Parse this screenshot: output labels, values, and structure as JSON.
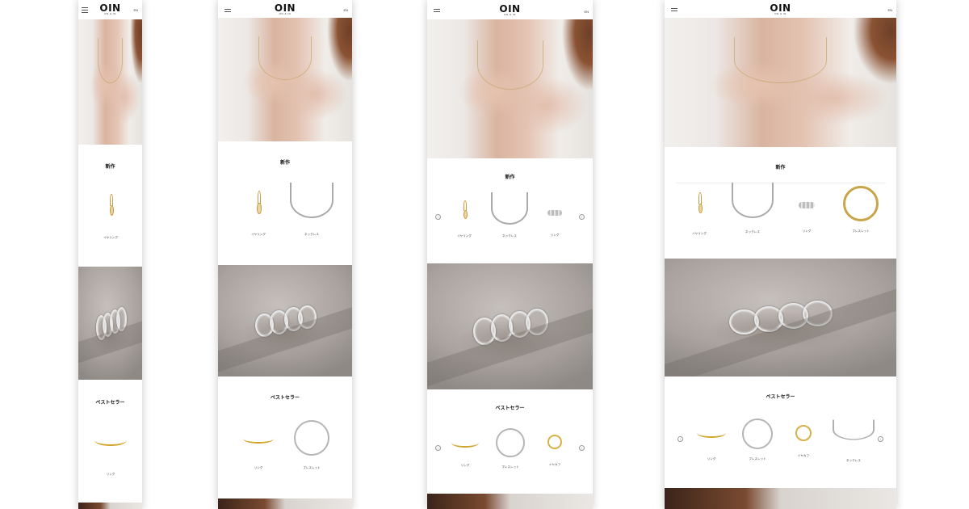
{
  "brand": {
    "logo_text": "OIN",
    "tagline": "ON & IN"
  },
  "header": {
    "language": "EN"
  },
  "sections": {
    "new_arrivals": "新作",
    "bestsellers": "ベストセラー"
  },
  "products": {
    "earring": "イヤリング",
    "necklace": "ネックレス",
    "ring": "リング",
    "bracelet": "ブレスレット",
    "ear_cuff": "イヤカフ"
  },
  "colors": {
    "gold": "#c69b3f",
    "silver": "#b5b5b5",
    "shadow": "#00000038"
  },
  "icons": [
    "menu-icon",
    "chevron-left-icon",
    "chevron-right-icon"
  ]
}
